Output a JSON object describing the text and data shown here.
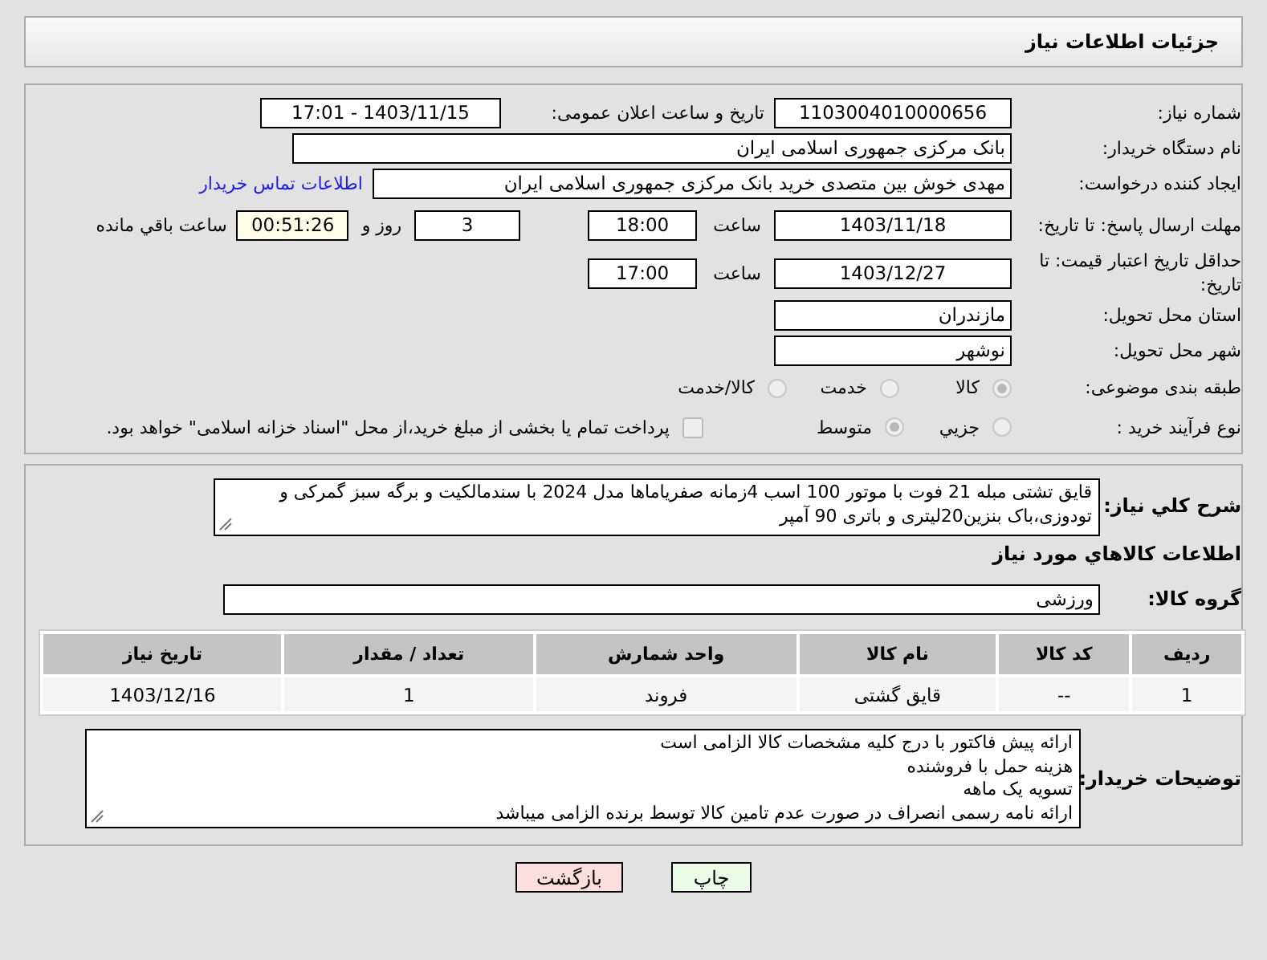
{
  "header": {
    "title": "جزئیات اطلاعات نیاز"
  },
  "details": {
    "need_number": {
      "label": "شماره نیاز:",
      "value": "1103004010000656"
    },
    "announce": {
      "label": "تاریخ و ساعت اعلان عمومی:",
      "value": "1403/11/15 - 17:01"
    },
    "buyer": {
      "label": "نام دستگاه خریدار:",
      "value": "بانک مرکزی جمهوری اسلامی ایران"
    },
    "requester": {
      "label": "ایجاد کننده درخواست:",
      "value": "مهدی خوش بین متصدی خرید بانک مرکزی جمهوری اسلامی ایران",
      "link": "اطلاعات تماس خریدار"
    },
    "deadline": {
      "label": "مهلت ارسال پاسخ: تا تاریخ:",
      "date": "1403/11/18",
      "time_label": "ساعت",
      "time": "18:00",
      "days": "3",
      "days_label": "روز و",
      "remaining": "00:51:26",
      "remaining_label": "ساعت باقي مانده"
    },
    "validity": {
      "label": "حداقل تاریخ اعتبار قیمت: تا تاریخ:",
      "date": "1403/12/27",
      "time_label": "ساعت",
      "time": "17:00"
    },
    "province": {
      "label": "استان محل تحویل:",
      "value": "مازندران"
    },
    "city": {
      "label": "شهر محل تحویل:",
      "value": "نوشهر"
    },
    "category": {
      "label": "طبقه بندی موضوعی:",
      "options": [
        {
          "label": "کالا",
          "selected": true
        },
        {
          "label": "خدمت",
          "selected": false
        },
        {
          "label": "کالا/خدمت",
          "selected": false
        }
      ]
    },
    "process": {
      "label": "نوع فرآیند خرید :",
      "options": [
        {
          "label": "جزيي",
          "selected": false
        },
        {
          "label": "متوسط",
          "selected": true
        }
      ],
      "treasury": {
        "label": "پرداخت تمام یا بخشی از مبلغ خرید،از محل \"اسناد خزانه اسلامی\" خواهد بود.",
        "checked": false
      }
    }
  },
  "goods": {
    "description": {
      "label": "شرح كلي نياز:",
      "value": "قایق تشتی مبله 21 فوت با موتور 100 اسب 4زمانه صفریاماها مدل 2024 با سندمالکیت و برگه سبز گمرکی و تودوزی،باک بنزین20لیتری و باتری 90 آمپر"
    },
    "heading": "اطلاعات كالاهاي مورد نياز",
    "group": {
      "label": "گروه كالا:",
      "value": "ورزشی"
    },
    "table": {
      "columns": [
        "ردیف",
        "کد کالا",
        "نام کالا",
        "واحد شمارش",
        "تعداد / مقدار",
        "تاریخ نیاز"
      ],
      "rows": [
        [
          "1",
          "--",
          "قایق گشتی",
          "فروند",
          "1",
          "1403/12/16"
        ]
      ]
    },
    "notes": {
      "label": "توضیحات خریدار:",
      "lines": [
        "ارائه پیش فاکتور با درج کلیه مشخصات کالا الزامی است",
        "هزینه حمل با فروشنده",
        "تسویه یک ماهه",
        "ارائه نامه رسمی انصراف در صورت عدم تامین کالا توسط برنده الزامی میباشد"
      ]
    }
  },
  "buttons": [
    {
      "label": "چاپ",
      "kind": "print"
    },
    {
      "label": "بازگشت",
      "kind": "back"
    }
  ]
}
